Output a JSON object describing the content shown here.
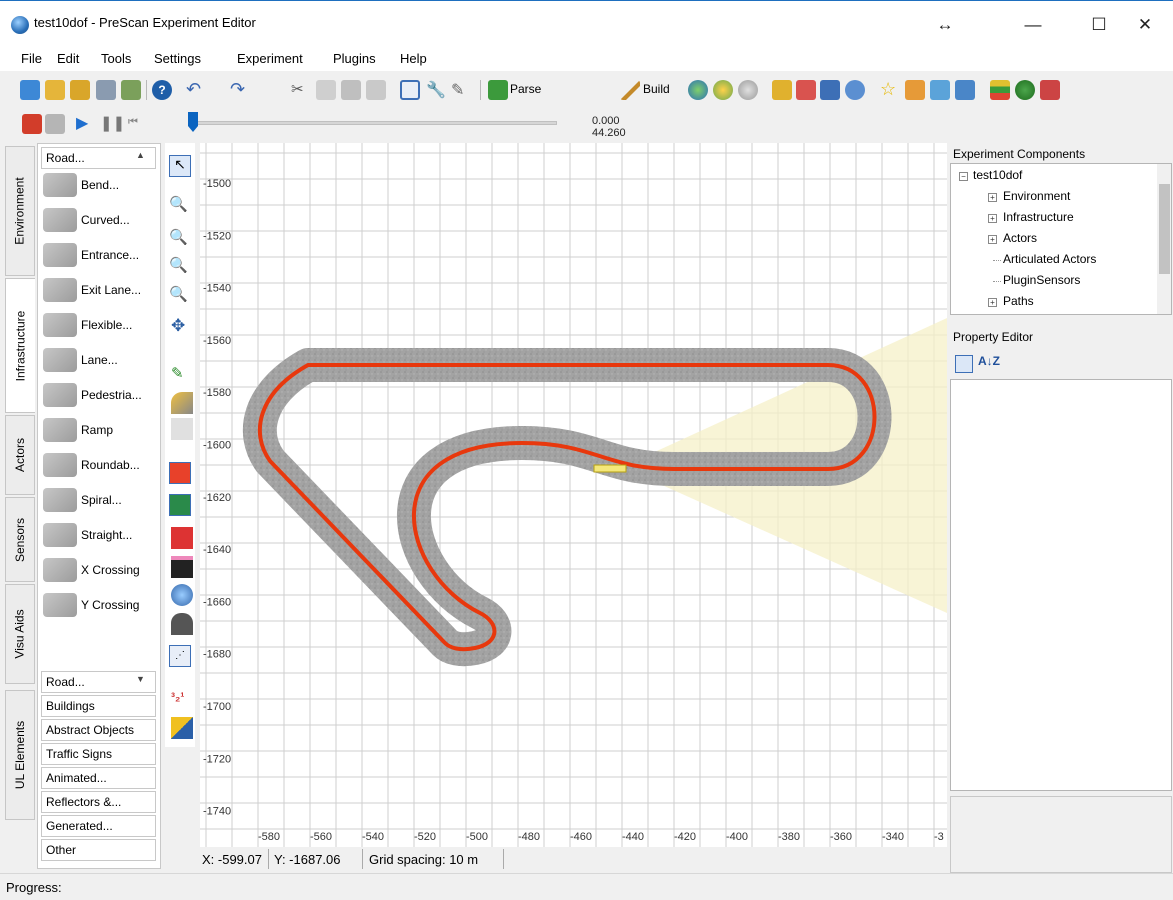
{
  "window": {
    "title": "test10dof - PreScan Experiment Editor",
    "resize_glyph": "↔",
    "minimize_glyph": "—",
    "maximize_glyph": "☐",
    "close_glyph": "✕"
  },
  "menu": [
    "File",
    "Edit",
    "Tools",
    "Settings",
    "Experiment",
    "Plugins",
    "Help"
  ],
  "toolbar": {
    "parse_label": "Parse",
    "build_label": "Build"
  },
  "playback": {
    "time_top": "0.000",
    "time_bottom": "44.260"
  },
  "left_tabs": [
    "Environment",
    "Infrastructure",
    "Actors",
    "Sensors",
    "Visu Aids",
    "UL Elements"
  ],
  "palette": {
    "header": "Road...",
    "items": [
      {
        "label": "Bend...",
        "icon": "bend-road-icon"
      },
      {
        "label": "Curved...",
        "icon": "curved-road-icon"
      },
      {
        "label": "Entrance...",
        "icon": "entrance-lane-icon"
      },
      {
        "label": "Exit Lane...",
        "icon": "exit-lane-icon"
      },
      {
        "label": "Flexible...",
        "icon": "flexible-road-icon"
      },
      {
        "label": "Lane...",
        "icon": "lane-icon"
      },
      {
        "label": "Pedestria...",
        "icon": "pedestrian-crossing-icon"
      },
      {
        "label": "Ramp",
        "icon": "ramp-icon"
      },
      {
        "label": "Roundab...",
        "icon": "roundabout-icon"
      },
      {
        "label": "Spiral...",
        "icon": "spiral-road-icon"
      },
      {
        "label": "Straight...",
        "icon": "straight-road-icon"
      },
      {
        "label": "X Crossing",
        "icon": "x-crossing-icon"
      },
      {
        "label": "Y Crossing",
        "icon": "y-crossing-icon"
      }
    ],
    "categories": [
      "Road...",
      "Buildings",
      "Abstract Objects",
      "Traffic Signs",
      "Animated...",
      "Reflectors &...",
      "Generated...",
      "Other"
    ]
  },
  "canvas": {
    "y_ticks": [
      "-1500",
      "-1520",
      "-1540",
      "-1560",
      "-1580",
      "-1600",
      "-1620",
      "-1640",
      "-1660",
      "-1680",
      "-1700",
      "-1720",
      "-1740"
    ],
    "x_ticks": [
      "-580",
      "-560",
      "-540",
      "-520",
      "-500",
      "-480",
      "-460",
      "-440",
      "-420",
      "-400",
      "-380",
      "-360",
      "-340",
      "-3"
    ]
  },
  "status": {
    "x": "X: -599.07",
    "y": "Y: -1687.06",
    "grid": "Grid spacing: 10 m",
    "progress": "Progress:"
  },
  "experiment_components": {
    "title": "Experiment Components",
    "root": "test10dof",
    "items": [
      {
        "label": "Environment",
        "expandable": true
      },
      {
        "label": "Infrastructure",
        "expandable": true
      },
      {
        "label": "Actors",
        "expandable": true
      },
      {
        "label": "Articulated Actors",
        "expandable": false
      },
      {
        "label": "PluginSensors",
        "expandable": false
      },
      {
        "label": "Paths",
        "expandable": true
      }
    ]
  },
  "property_editor": {
    "title": "Property Editor",
    "sort_glyph": "A↓Z"
  },
  "colors": {
    "path_red": "#e8380d",
    "road_gray": "#9a9a9a",
    "grid": "#cfcfcf",
    "sensor_cone": "#f5f0c8",
    "accent_blue": "#0b64c0"
  }
}
